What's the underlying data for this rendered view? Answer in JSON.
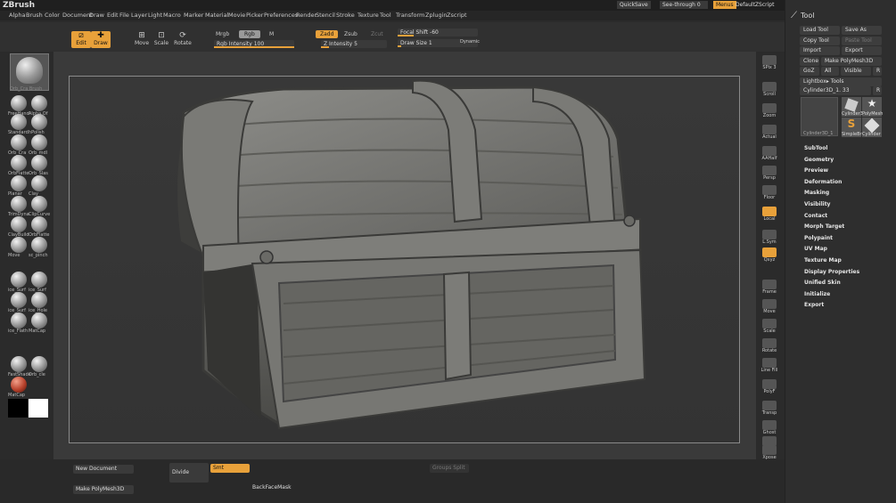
{
  "app": {
    "title": "ZBrush"
  },
  "menus": [
    "Alpha",
    "Brush",
    "Color",
    "Document",
    "Draw",
    "Edit",
    "File",
    "Layer",
    "Light",
    "Macro",
    "Marker",
    "Material",
    "Movie",
    "Picker",
    "Preferences",
    "Render",
    "Stencil",
    "Stroke",
    "Texture",
    "Tool",
    "Transform",
    "Zplugin",
    "Zscript"
  ],
  "topright": {
    "quicksave": "QuickSave",
    "seethrough": "See-through",
    "seethrough_val": "0",
    "menus": "Menus",
    "script": "DefaultZScript"
  },
  "modes": {
    "edit": "Edit",
    "draw": "Draw",
    "move": "Move",
    "scale": "Scale",
    "rotate": "Rotate"
  },
  "color": {
    "mrgb": "Mrgb",
    "rgb": "Rgb",
    "m": "M",
    "rgb_intensity": "Rgb Intensity",
    "rgb_intensity_val": "100",
    "zadd": "Zadd",
    "zsub": "Zsub",
    "zcut": "Zcut",
    "z_intensity": "Z Intensity",
    "z_intensity_val": "5",
    "focal_shift": "Focal Shift",
    "focal_shift_val": "-60",
    "draw_size": "Draw Size",
    "draw_size_val": "1",
    "dynamic": "Dynamic"
  },
  "brushes": [
    {
      "n": "FreeHand"
    },
    {
      "n": "Alpha Of"
    },
    {
      "n": "Standard"
    },
    {
      "n": "hPolish"
    },
    {
      "n": "Orb_Cra"
    },
    {
      "n": "Orb_mdl"
    },
    {
      "n": "OrbFlatte"
    },
    {
      "n": "Orb_Slas"
    },
    {
      "n": "Planar"
    },
    {
      "n": "Clay"
    },
    {
      "n": "TrimDyna"
    },
    {
      "n": "ClipCurve"
    },
    {
      "n": "ClayBuild"
    },
    {
      "n": "OrbFlatte"
    },
    {
      "n": "Move"
    },
    {
      "n": "sc_pinch"
    },
    {
      "n": "ice_Surf"
    },
    {
      "n": "ice_Surf"
    },
    {
      "n": "ice_Surf"
    },
    {
      "n": "ice_Hole"
    },
    {
      "n": "ice_Flath"
    },
    {
      "n": "MatCap"
    },
    {
      "n": "FastShade"
    },
    {
      "n": "Orb_cle"
    },
    {
      "n": "MatCap"
    }
  ],
  "current_brush": "Orb_Cra Brush",
  "rightshelf": [
    "SPix 3",
    "Scroll",
    "Zoom",
    "Actual",
    "AAHalf",
    "Persp",
    "Floor",
    "Local",
    "L.Sym",
    "Qxyz",
    "Frame",
    "Move",
    "Scale",
    "Rotate",
    "Line Fill",
    "PolyF",
    "Transp",
    "Ghost",
    "Solo",
    "Xpose"
  ],
  "bottom": {
    "new_doc": "New Document",
    "make_poly": "Make PolyMesh3D",
    "divide": "Divide",
    "smt": "Smt",
    "groups_split": "Groups Split",
    "backface": "BackFaceMask"
  },
  "tool": {
    "title": "Tool",
    "load": "Load Tool",
    "save_as": "Save As",
    "copy": "Copy Tool",
    "paste": "Paste Tool",
    "import": "Import",
    "export": "Export",
    "clone": "Clone",
    "make_poly": "Make PolyMesh3D",
    "goz": "GoZ",
    "all": "All",
    "visible": "Visible",
    "r": "R",
    "lightbox": "Lightbox▸ Tools",
    "current": "Cylinder3D_1. 33",
    "r2": "R",
    "thumbs": [
      "Cylinder3",
      "PolyMesh",
      "SimpleBr",
      "Cylinder"
    ],
    "thumb_big": "Cylinder3D_1",
    "sections": [
      "SubTool",
      "Geometry",
      "Preview",
      "Deformation",
      "Masking",
      "Visibility",
      "Contact",
      "Morph Target",
      "Polypaint",
      "UV Map",
      "Texture Map",
      "Display Properties",
      "Unified Skin",
      "Initialize",
      "Export"
    ]
  },
  "colors": {
    "accent": "#e8a13a",
    "panel": "#2e2e2e",
    "bg": "#2b2b2b"
  }
}
